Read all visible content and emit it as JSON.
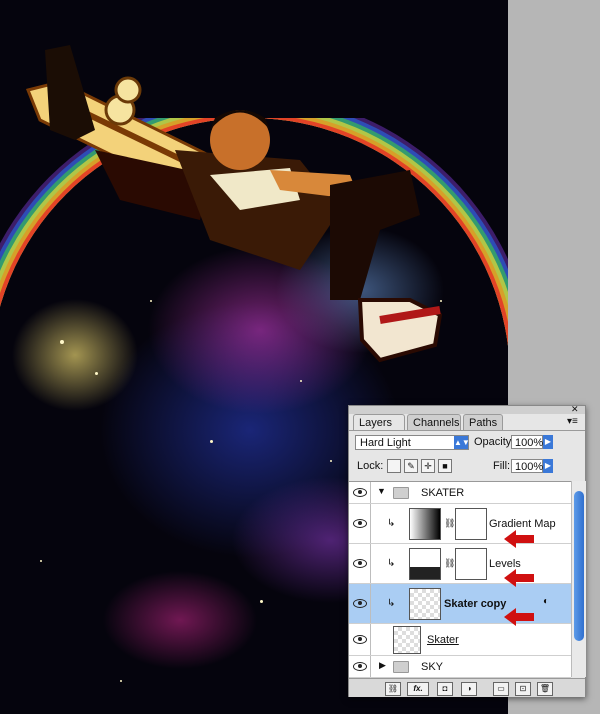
{
  "layers_panel": {
    "tabs": [
      "Layers",
      "Channels",
      "Paths"
    ],
    "tab_close": "×",
    "blend_mode": "Hard Light",
    "opacity_label": "Opacity:",
    "opacity_value": "100%",
    "lock_label": "Lock:",
    "fill_label": "Fill:",
    "fill_value": "100%",
    "layers": [
      {
        "name": "SKATER",
        "kind": "group"
      },
      {
        "name": "Gradient Map",
        "kind": "adjustment"
      },
      {
        "name": "Levels",
        "kind": "adjustment"
      },
      {
        "name": "Skater copy",
        "kind": "smart-object",
        "selected": true
      },
      {
        "name": "Skater",
        "kind": "layer"
      },
      {
        "name": "SKY",
        "kind": "group"
      }
    ],
    "fx_label": "fx."
  },
  "colors": {
    "arrow": "#d01010",
    "selection": "#aacdf3",
    "accent": "#3a78d8"
  }
}
